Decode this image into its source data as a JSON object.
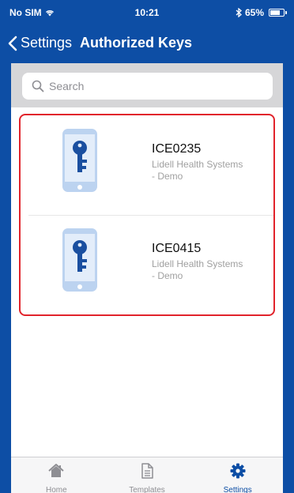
{
  "status_bar": {
    "carrier": "No SIM",
    "time": "10:21",
    "battery_percent": "65%",
    "battery_level": 0.65
  },
  "nav": {
    "back_label": "Settings",
    "title": "Authorized Keys"
  },
  "search": {
    "placeholder": "Search"
  },
  "keys": [
    {
      "id": "ICE0235",
      "org_line1": "Lidell Health Systems",
      "org_line2": "- Demo"
    },
    {
      "id": "ICE0415",
      "org_line1": "Lidell Health Systems",
      "org_line2": "- Demo"
    }
  ],
  "tabs": [
    {
      "label": "Home",
      "icon": "home-icon",
      "active": false
    },
    {
      "label": "Templates",
      "icon": "document-icon",
      "active": false
    },
    {
      "label": "Settings",
      "icon": "gear-icon",
      "active": true
    }
  ],
  "colors": {
    "brand": "#0d4ea5",
    "highlight": "#e1232b",
    "key_icon": "#1a4fa0",
    "phone_body": "#bcd3f0"
  }
}
